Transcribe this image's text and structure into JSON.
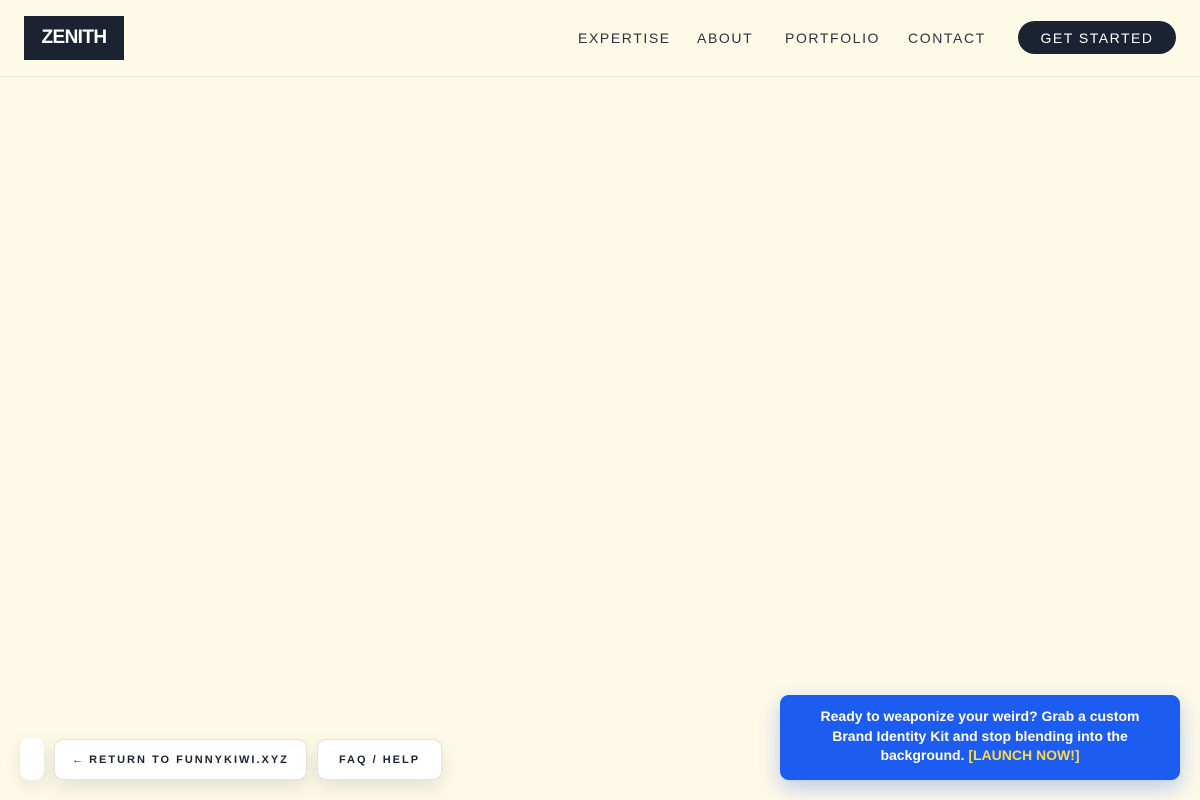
{
  "header": {
    "logo": "ZENITH",
    "nav": [
      "EXPERTISE",
      "ABOUT",
      "PORTFOLIO",
      "CONTACT"
    ],
    "cta_label": "GET STARTED"
  },
  "footer_bar": {
    "return_arrow": "←",
    "return_label": "RETURN TO FUNNYKIWI.XYZ",
    "faq_label": "FAQ / HELP"
  },
  "promo": {
    "text": "Ready to weaponize your weird? Grab a custom Brand Identity Kit and stop blending into the background.",
    "link_label": "[LAUNCH NOW!]"
  },
  "colors": {
    "background": "#fefae8",
    "dark": "#1b2333",
    "promo_blue": "#1d5cf0",
    "promo_link": "#ffd84d"
  }
}
